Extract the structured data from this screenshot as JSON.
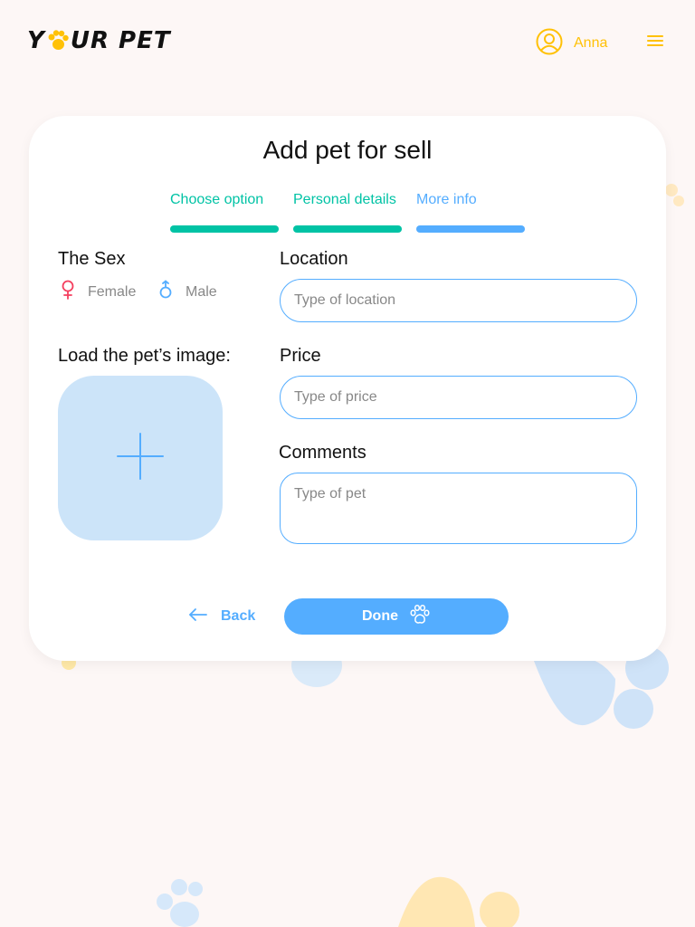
{
  "colors": {
    "accent_blue": "#54adff",
    "accent_yellow": "#ffc107",
    "step_done": "#00c3a5",
    "upload_bg": "#cce4f9",
    "female": "#f43f5e",
    "background": "#fdf7f6"
  },
  "header": {
    "logo_left": "Y",
    "logo_right": "UR PET",
    "logo_icon": "paw-icon",
    "user_name": "Anna",
    "user_icon": "user-circle-icon",
    "menu_icon": "burger-menu-icon"
  },
  "form": {
    "title": "Add pet for sell",
    "steps": [
      {
        "label": "Choose  option",
        "state": "done"
      },
      {
        "label": "Personal details",
        "state": "done"
      },
      {
        "label": "More info",
        "state": "active"
      }
    ],
    "sex": {
      "label": "The Sex",
      "female": "Female",
      "male": "Male"
    },
    "image": {
      "label": "Load the pet’s image:",
      "icon": "plus-icon"
    },
    "location": {
      "label": "Location",
      "placeholder": "Type of location",
      "value": ""
    },
    "price": {
      "label": "Price",
      "placeholder": "Type of price",
      "value": ""
    },
    "comments": {
      "label": "Comments",
      "placeholder": "Type of pet",
      "value": ""
    },
    "back_label": "Back",
    "done_label": "Done"
  }
}
